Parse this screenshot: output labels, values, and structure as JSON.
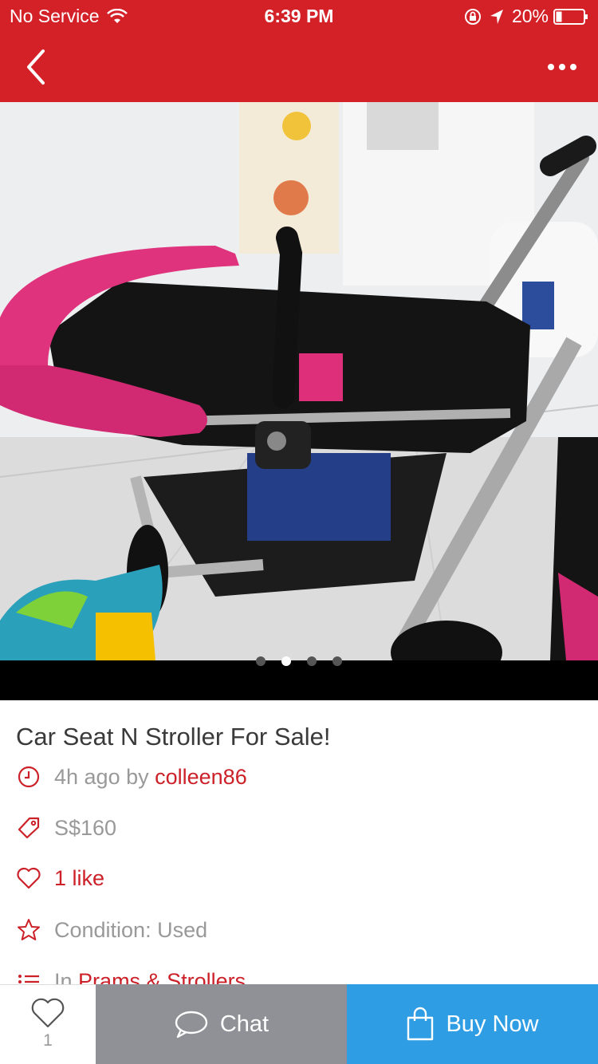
{
  "status_bar": {
    "carrier": "No Service",
    "time": "6:39 PM",
    "battery": "20%"
  },
  "nav": {
    "back_icon": "chevron-left-icon",
    "more_icon": "more-dots-icon"
  },
  "gallery": {
    "photo_subject": "pink and black baby stroller",
    "page_count": 4,
    "current_page": 2
  },
  "listing": {
    "title": "Car Seat N Stroller For Sale!",
    "time_ago": "4h ago by",
    "seller": "colleen86",
    "price": "S$160",
    "likes": "1 like",
    "condition": "Condition: Used",
    "category_prefix": "In",
    "category": "Prams & Strollers"
  },
  "bottom_bar": {
    "like_count": "1",
    "chat_label": "Chat",
    "buy_label": "Buy Now"
  },
  "colors": {
    "brand_red": "#d42127",
    "link_red": "#cc2129",
    "chat_gray": "#8f9196",
    "buy_blue": "#2e9de3"
  }
}
